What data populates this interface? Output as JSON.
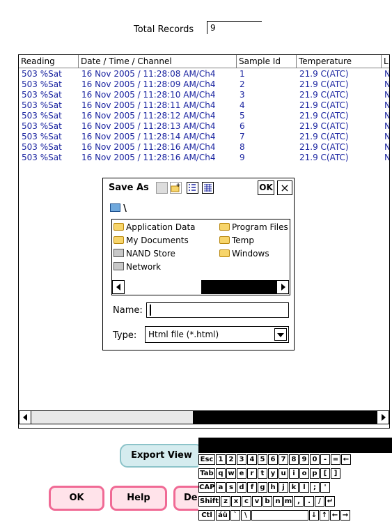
{
  "total_records": {
    "label": "Total Records",
    "value": "9"
  },
  "listview": {
    "columns": [
      "Reading",
      "Date / Time / Channel",
      "Sample Id",
      "Temperature",
      "L"
    ],
    "rows": [
      [
        "503  %Sat",
        "16 Nov 2005 / 11:28:08 AM/Ch4",
        "1",
        "21.9 C(ATC)",
        "N"
      ],
      [
        "503  %Sat",
        "16 Nov 2005 / 11:28:09 AM/Ch4",
        "2",
        "21.9 C(ATC)",
        "N"
      ],
      [
        "503  %Sat",
        "16 Nov 2005 / 11:28:10 AM/Ch4",
        "3",
        "21.9 C(ATC)",
        "N"
      ],
      [
        "503  %Sat",
        "16 Nov 2005 / 11:28:11 AM/Ch4",
        "4",
        "21.9 C(ATC)",
        "N"
      ],
      [
        "503  %Sat",
        "16 Nov 2005 / 11:28:12 AM/Ch4",
        "5",
        "21.9 C(ATC)",
        "N"
      ],
      [
        "503  %Sat",
        "16 Nov 2005 / 11:28:13 AM/Ch4",
        "6",
        "21.9 C(ATC)",
        "N"
      ],
      [
        "503  %Sat",
        "16 Nov 2005 / 11:28:14 AM/Ch4",
        "7",
        "21.9 C(ATC)",
        "N"
      ],
      [
        "503  %Sat",
        "16 Nov 2005 / 11:28:16 AM/Ch4",
        "8",
        "21.9 C(ATC)",
        "N"
      ],
      [
        "503  %Sat",
        "16 Nov 2005 / 11:28:16 AM/Ch4",
        "9",
        "21.9 C(ATC)",
        "N"
      ]
    ]
  },
  "buttons": {
    "export": "Export View",
    "ok": "OK",
    "help": "Help",
    "delete": "De"
  },
  "dialog": {
    "title": "Save As",
    "ok": "OK",
    "close": "×",
    "path": "\\",
    "folders": [
      {
        "name": "Application Data",
        "icon": "folder-icon"
      },
      {
        "name": "My Documents",
        "icon": "folder-icon"
      },
      {
        "name": "NAND Store",
        "icon": "storage-icon"
      },
      {
        "name": "Network",
        "icon": "network-icon"
      },
      {
        "name": "Program Files",
        "icon": "folder-icon"
      },
      {
        "name": "Temp",
        "icon": "folder-icon"
      },
      {
        "name": "Windows",
        "icon": "folder-icon"
      }
    ],
    "name_label": "Name:",
    "name_value": "",
    "type_label": "Type:",
    "type_value": "Html file (*.html)"
  },
  "keyboard": {
    "row1": [
      "Esc",
      "1",
      "2",
      "3",
      "4",
      "5",
      "6",
      "7",
      "8",
      "9",
      "0",
      "-",
      "=",
      "←"
    ],
    "row2": [
      "Tab",
      "q",
      "w",
      "e",
      "r",
      "t",
      "y",
      "u",
      "i",
      "o",
      "p",
      "[",
      "]"
    ],
    "row3": [
      "CAP",
      "a",
      "s",
      "d",
      "f",
      "g",
      "h",
      "j",
      "k",
      "l",
      ";",
      "'"
    ],
    "row4": [
      "Shift",
      "z",
      "x",
      "c",
      "v",
      "b",
      "n",
      "m",
      ",",
      ".",
      "/",
      "↵"
    ],
    "row5": [
      "Ctl",
      "áü",
      "`",
      "\\",
      "",
      "↓",
      "↑",
      "←",
      "→"
    ]
  }
}
